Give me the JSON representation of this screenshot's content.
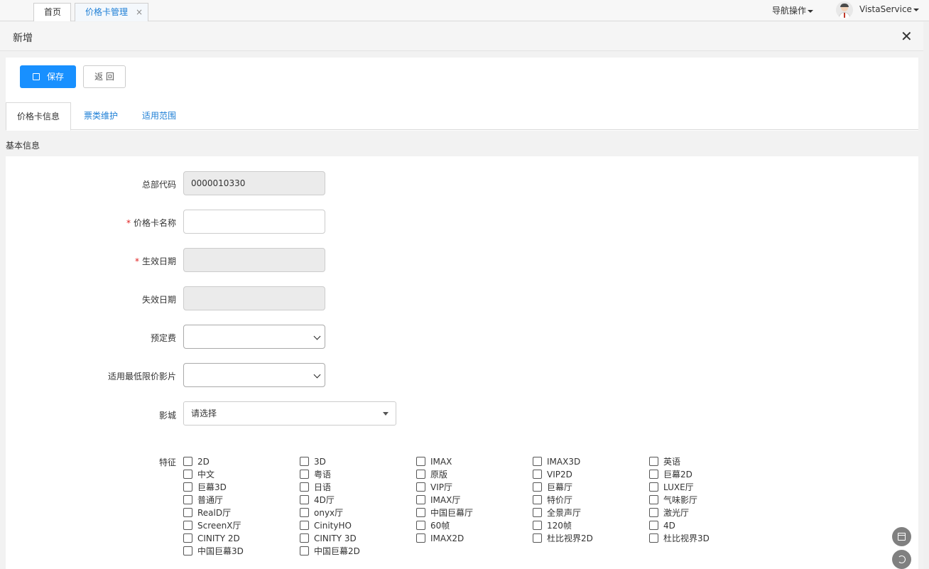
{
  "top_tabs": {
    "home": "首页",
    "price_card": "价格卡管理",
    "close": "×"
  },
  "header": {
    "nav_ops": "导航操作",
    "username": "VistaService"
  },
  "page": {
    "title": "新增",
    "close": "✕"
  },
  "toolbar": {
    "save": "保存",
    "back": "返 回"
  },
  "form_tabs": [
    "价格卡信息",
    "票类维护",
    "适用范围"
  ],
  "section_title": "基本信息",
  "fields": {
    "hq_code": {
      "label": "总部代码",
      "value": "0000010330"
    },
    "card_name": {
      "label": "价格卡名称",
      "required": "*",
      "value": ""
    },
    "effective_date": {
      "label": "生效日期",
      "required": "*",
      "value": ""
    },
    "expiry_date": {
      "label": "失效日期",
      "value": ""
    },
    "booking_fee": {
      "label": "预定费",
      "value": ""
    },
    "min_price_film": {
      "label": "适用最低限价影片",
      "value": ""
    },
    "cinema": {
      "label": "影城",
      "placeholder": "请选择"
    }
  },
  "features": {
    "label": "特征",
    "items": [
      "2D",
      "3D",
      "IMAX",
      "IMAX3D",
      "英语",
      "中文",
      "粤语",
      "原版",
      "VIP2D",
      "巨幕2D",
      "巨幕3D",
      "日语",
      "VIP厅",
      "巨幕厅",
      "LUXE厅",
      "普通厅",
      "4D厅",
      "IMAX厅",
      "特价厅",
      "气味影厅",
      "RealD厅",
      "onyx厅",
      "中国巨幕厅",
      "全景声厅",
      "激光厅",
      "ScreenX厅",
      "CinityHO",
      "60帧",
      "120帧",
      "4D",
      "CINITY 2D",
      "CINITY 3D",
      "IMAX2D",
      "杜比视界2D",
      "杜比视界3D",
      "中国巨幕3D",
      "中国巨幕2D"
    ]
  }
}
